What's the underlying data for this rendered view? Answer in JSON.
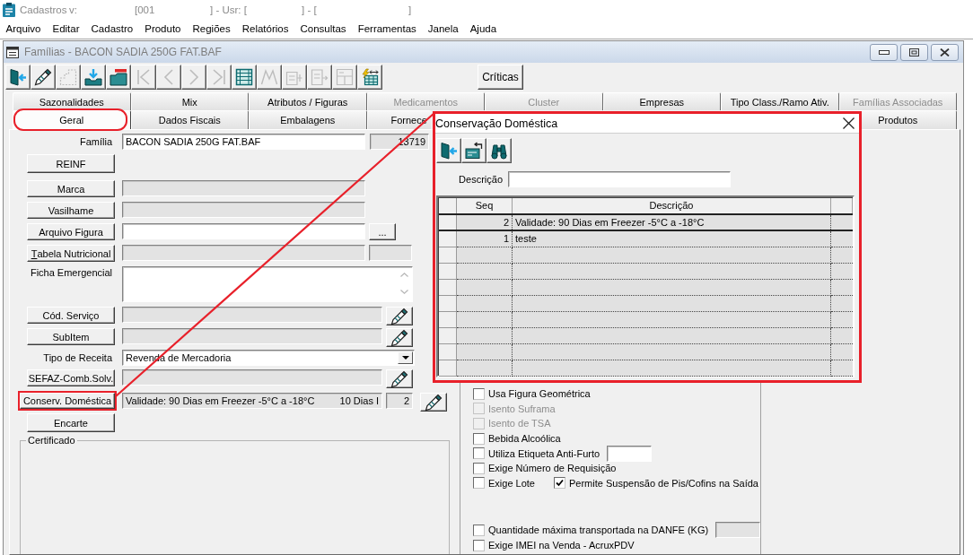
{
  "app_title": [
    "Cadastros",
    "v:",
    "[001",
    "] - Usr: [",
    "] - [",
    "]"
  ],
  "menu": [
    "Arquivo",
    "Editar",
    "Cadastro",
    "Produto",
    "Regiões",
    "Relatórios",
    "Consultas",
    "Ferramentas",
    "Janela",
    "Ajuda"
  ],
  "window": {
    "title": "Famílias - BACON SADIA 250G FAT.BAF",
    "active": false
  },
  "toolbar": [
    {
      "kind": "door",
      "disabled": false
    },
    {
      "kind": "pen",
      "disabled": false
    },
    {
      "kind": "stairs",
      "disabled": true
    },
    {
      "kind": "tray",
      "disabled": false
    },
    {
      "kind": "folder-minus",
      "disabled": false
    },
    {
      "kind": "first",
      "disabled": true
    },
    {
      "kind": "prev",
      "disabled": true
    },
    {
      "kind": "next",
      "disabled": true
    },
    {
      "kind": "last",
      "disabled": true
    },
    {
      "kind": "table",
      "disabled": false
    },
    {
      "kind": "peaks",
      "disabled": true
    },
    {
      "kind": "form-plus",
      "disabled": true
    },
    {
      "kind": "form-arrow",
      "disabled": true
    },
    {
      "kind": "form-split",
      "disabled": true
    },
    {
      "kind": "bolt-table",
      "disabled": false
    }
  ],
  "toolbar_button": "Críticas",
  "tabs_row_1": [
    {
      "label": "Sazonalidades",
      "selected": false,
      "disabled": false
    },
    {
      "label": "Mix",
      "selected": false,
      "disabled": false
    },
    {
      "label": "Atributos / Figuras",
      "selected": false,
      "disabled": false
    },
    {
      "label": "Medicamentos",
      "selected": false,
      "disabled": true
    },
    {
      "label": "Cluster",
      "selected": false,
      "disabled": true
    },
    {
      "label": "Empresas",
      "selected": false,
      "disabled": false
    },
    {
      "label": "Tipo Class./Ramo Ativ.",
      "selected": false,
      "disabled": false
    },
    {
      "label": "Famílias Associadas",
      "selected": false,
      "disabled": true
    }
  ],
  "tabs_row_2": [
    {
      "label": "Geral",
      "selected": true,
      "disabled": false,
      "highlighted": true
    },
    {
      "label": "Dados Fiscais",
      "selected": false,
      "disabled": false,
      "highlighted": false
    },
    {
      "label": "Embalagens",
      "selected": false,
      "disabled": false,
      "highlighted": false
    },
    {
      "label": "Fornece",
      "selected": false,
      "disabled": false,
      "highlighted": false
    },
    {
      "label": "Produtos",
      "selected": false,
      "disabled": false,
      "highlighted": false
    }
  ],
  "form": {
    "rows": [
      {
        "kind": "text",
        "label": "Família",
        "value": "BACON SADIA 250G FAT.BAF",
        "code": "13719"
      },
      {
        "kind": "button",
        "button": "REINF",
        "mnemonic": false,
        "highlighted": false
      },
      {
        "kind": "lookup",
        "button": "Marca",
        "mnemonic": false,
        "highlighted": false
      },
      {
        "kind": "lookup",
        "button": "Vasilhame",
        "mnemonic": false,
        "highlighted": false
      },
      {
        "kind": "browse",
        "button": "Arquivo Figura",
        "browse": "...",
        "mnemonic": false,
        "highlighted": false
      },
      {
        "kind": "lookup_code",
        "button": "Tabela Nutricional",
        "mnemonic": true,
        "highlighted": false
      },
      {
        "kind": "memo",
        "label": "Ficha Emergencial"
      },
      {
        "kind": "lookup_edit",
        "button": "Cód. Serviço",
        "mnemonic": false,
        "highlighted": false
      },
      {
        "kind": "lookup_edit",
        "button": "SubItem",
        "mnemonic": false,
        "highlighted": false
      },
      {
        "kind": "select",
        "label": "Tipo de Receita",
        "value": "Revenda de Mercadoria"
      },
      {
        "kind": "lookup_edit",
        "button": "SEFAZ-Comb.Solv.",
        "mnemonic": false,
        "highlighted": false
      },
      {
        "kind": "lookup_seq",
        "button": "Conserv. Doméstica",
        "value": "Validade: 90 Dias em Freezer -5°C a -18°C",
        "trailing_text": "10 Dias I",
        "seq": "2",
        "mnemonic": false,
        "highlighted": true
      },
      {
        "kind": "button",
        "button": "Encarte",
        "mnemonic": false,
        "highlighted": false
      }
    ],
    "group_title": "Certificado"
  },
  "options": [
    {
      "kind": "plain",
      "label": "Usa Figura Geométrica",
      "checked": false,
      "disabled": false
    },
    {
      "kind": "plain",
      "label": "Isento Suframa",
      "checked": false,
      "disabled": true
    },
    {
      "kind": "plain",
      "label": "Isento de TSA",
      "checked": false,
      "disabled": true
    },
    {
      "kind": "plain",
      "label": "Bebida Alcoólica",
      "checked": false,
      "disabled": false
    },
    {
      "kind": "field",
      "label": "Utiliza Etiqueta Anti-Furto",
      "checked": false,
      "disabled": false,
      "field_disabled": false
    },
    {
      "kind": "plain",
      "label": "Exige Número de Requisição",
      "checked": false,
      "disabled": false
    },
    {
      "kind": "paired",
      "label": "Exige Lote",
      "checked": false,
      "disabled": false,
      "paired": {
        "label": "Permite Suspensão de Pis/Cofins na Saída",
        "checked": true,
        "disabled": false
      }
    }
  ],
  "options_lower": [
    {
      "kind": "field",
      "label": "Quantidade máxima transportada na DANFE (KG)",
      "checked": false,
      "disabled": false,
      "field_disabled": true
    },
    {
      "kind": "plain",
      "label": "Exige IMEI na Venda - AcruxPDV",
      "checked": false,
      "disabled": false
    }
  ],
  "dialog": {
    "title": "Conservação Doméstica",
    "highlighted": true,
    "toolbar": [
      {
        "kind": "door",
        "disabled": false
      },
      {
        "kind": "card-undo",
        "disabled": false
      },
      {
        "kind": "binoculars",
        "disabled": false
      }
    ],
    "filter_label": "Descrição",
    "grid": {
      "columns": [
        "Seq",
        "Descrição"
      ],
      "rows": [
        {
          "seq": "2",
          "description": "Validade: 90 Dias em Freezer -5°C a -18°C",
          "selected": true
        },
        {
          "seq": "1",
          "description": "teste",
          "selected": false
        }
      ]
    }
  }
}
